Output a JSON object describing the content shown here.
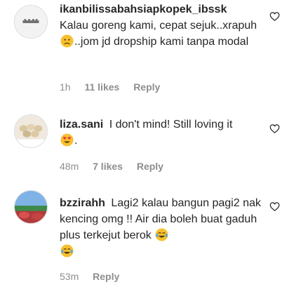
{
  "comments": [
    {
      "username": "ikanbilissabahsiapkopek_ibssk",
      "text_a": "Kalau goreng kami, cepat sejuk..xrapuh",
      "emoji": "worried-face",
      "text_b": "..jom jd dropship kami tanpa modal",
      "time": "1h",
      "likes": "11 likes",
      "reply": "Reply"
    },
    {
      "username": "liza.sani",
      "text_a": "I don't mind! Still loving it",
      "emoji": "heart-eyes-face",
      "text_b": ".",
      "time": "48m",
      "likes": "7 likes",
      "reply": "Reply"
    },
    {
      "username": "bzzirahh",
      "text_a": "Lagi2 kalau bangun pagi2 nak kencing omg !! Air dia boleh buat gaduh plus terkejut berok",
      "emoji": "tears-of-joy-face",
      "emoji_count": 2,
      "time": "53m",
      "reply": "Reply"
    }
  ],
  "icons": {
    "like": "heart-outline-icon",
    "like_color": "#262626",
    "meta_color": "#8e8e8e"
  }
}
